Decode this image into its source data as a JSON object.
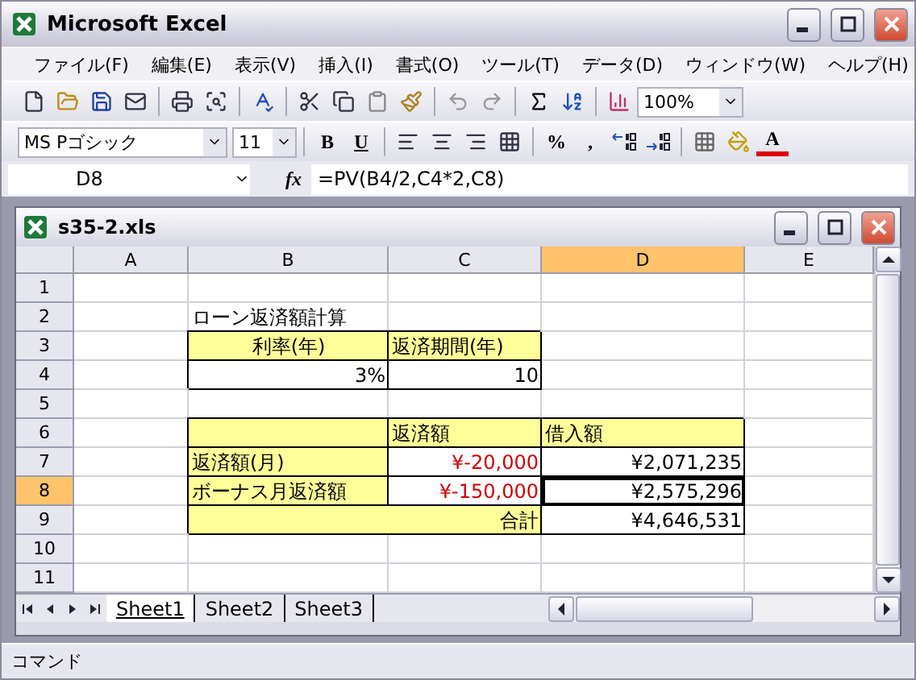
{
  "window": {
    "title": "Microsoft Excel"
  },
  "menu": [
    "ファイル(F)",
    "編集(E)",
    "表示(V)",
    "挿入(I)",
    "書式(O)",
    "ツール(T)",
    "データ(D)",
    "ウィンドウ(W)",
    "ヘルプ(H)"
  ],
  "standard_toolbar": {
    "zoom": "100%"
  },
  "formatting_toolbar": {
    "font": "MS Pゴシック",
    "size": "11",
    "bold": "B",
    "underline": "U",
    "percent": "%",
    "comma": ",",
    "font_color": "A"
  },
  "formula_bar": {
    "name_box": "D8",
    "function_label": "fx",
    "formula": "=PV(B4/2,C4*2,C8)"
  },
  "workbook": {
    "title": "s35-2.xls",
    "columns": [
      {
        "label": "A",
        "selected": false
      },
      {
        "label": "B",
        "selected": false
      },
      {
        "label": "C",
        "selected": false
      },
      {
        "label": "D",
        "selected": true
      },
      {
        "label": "E",
        "selected": false
      }
    ],
    "rows": [
      {
        "label": "1",
        "selected": false,
        "cells": [
          {},
          {},
          {},
          {},
          {}
        ]
      },
      {
        "label": "2",
        "selected": false,
        "cells": [
          {},
          {
            "text": "ローン返済額計算",
            "kind": "text"
          },
          {},
          {},
          {}
        ]
      },
      {
        "label": "3",
        "selected": false,
        "cells": [
          {},
          {
            "text": "利率(年)",
            "kind": "caption",
            "highlighted": true,
            "boxed": true
          },
          {
            "text": "返済期間(年)",
            "kind": "text",
            "highlighted": true,
            "boxed": true
          },
          {},
          {}
        ]
      },
      {
        "label": "4",
        "selected": false,
        "cells": [
          {},
          {
            "text": "3%",
            "kind": "number",
            "boxed": true
          },
          {
            "text": "10",
            "kind": "number",
            "boxed": true
          },
          {},
          {}
        ]
      },
      {
        "label": "5",
        "selected": false,
        "cells": [
          {},
          {},
          {},
          {},
          {}
        ]
      },
      {
        "label": "6",
        "selected": false,
        "cells": [
          {},
          {
            "highlighted": true,
            "boxed": true
          },
          {
            "text": "返済額",
            "kind": "text",
            "highlighted": true,
            "boxed": true
          },
          {
            "text": "借入額",
            "kind": "text",
            "highlighted": true,
            "boxed": true
          },
          {}
        ]
      },
      {
        "label": "7",
        "selected": false,
        "cells": [
          {},
          {
            "text": "返済額(月)",
            "kind": "text",
            "highlighted": true,
            "boxed": true
          },
          {
            "text": "¥-20,000",
            "kind": "number",
            "negative": true,
            "boxed": true
          },
          {
            "text": "¥2,071,235",
            "kind": "number",
            "boxed": true
          },
          {}
        ]
      },
      {
        "label": "8",
        "selected": true,
        "cells": [
          {},
          {
            "text": "ボーナス月返済額",
            "kind": "text",
            "highlighted": true,
            "boxed": true
          },
          {
            "text": "¥-150,000",
            "kind": "number",
            "negative": true,
            "boxed": true
          },
          {
            "text": "¥2,575,296",
            "kind": "number",
            "boxed": true
          },
          {}
        ]
      },
      {
        "label": "9",
        "selected": false,
        "cells": [
          {},
          {
            "text": "合計",
            "kind": "total",
            "highlighted": true,
            "boxed": true
          },
          {
            "kind": "merged"
          },
          {
            "text": "¥4,646,531",
            "kind": "number",
            "boxed": true
          },
          {}
        ]
      },
      {
        "label": "10",
        "selected": false,
        "cells": [
          {},
          {},
          {},
          {},
          {}
        ]
      },
      {
        "label": "11",
        "selected": false,
        "cells": [
          {},
          {},
          {},
          {},
          {}
        ]
      }
    ],
    "sheets": [
      {
        "label": "Sheet1",
        "selected": true
      },
      {
        "label": "Sheet2",
        "selected": false
      },
      {
        "label": "Sheet3",
        "selected": false
      }
    ]
  },
  "status_bar": {
    "text": "コマンド"
  }
}
